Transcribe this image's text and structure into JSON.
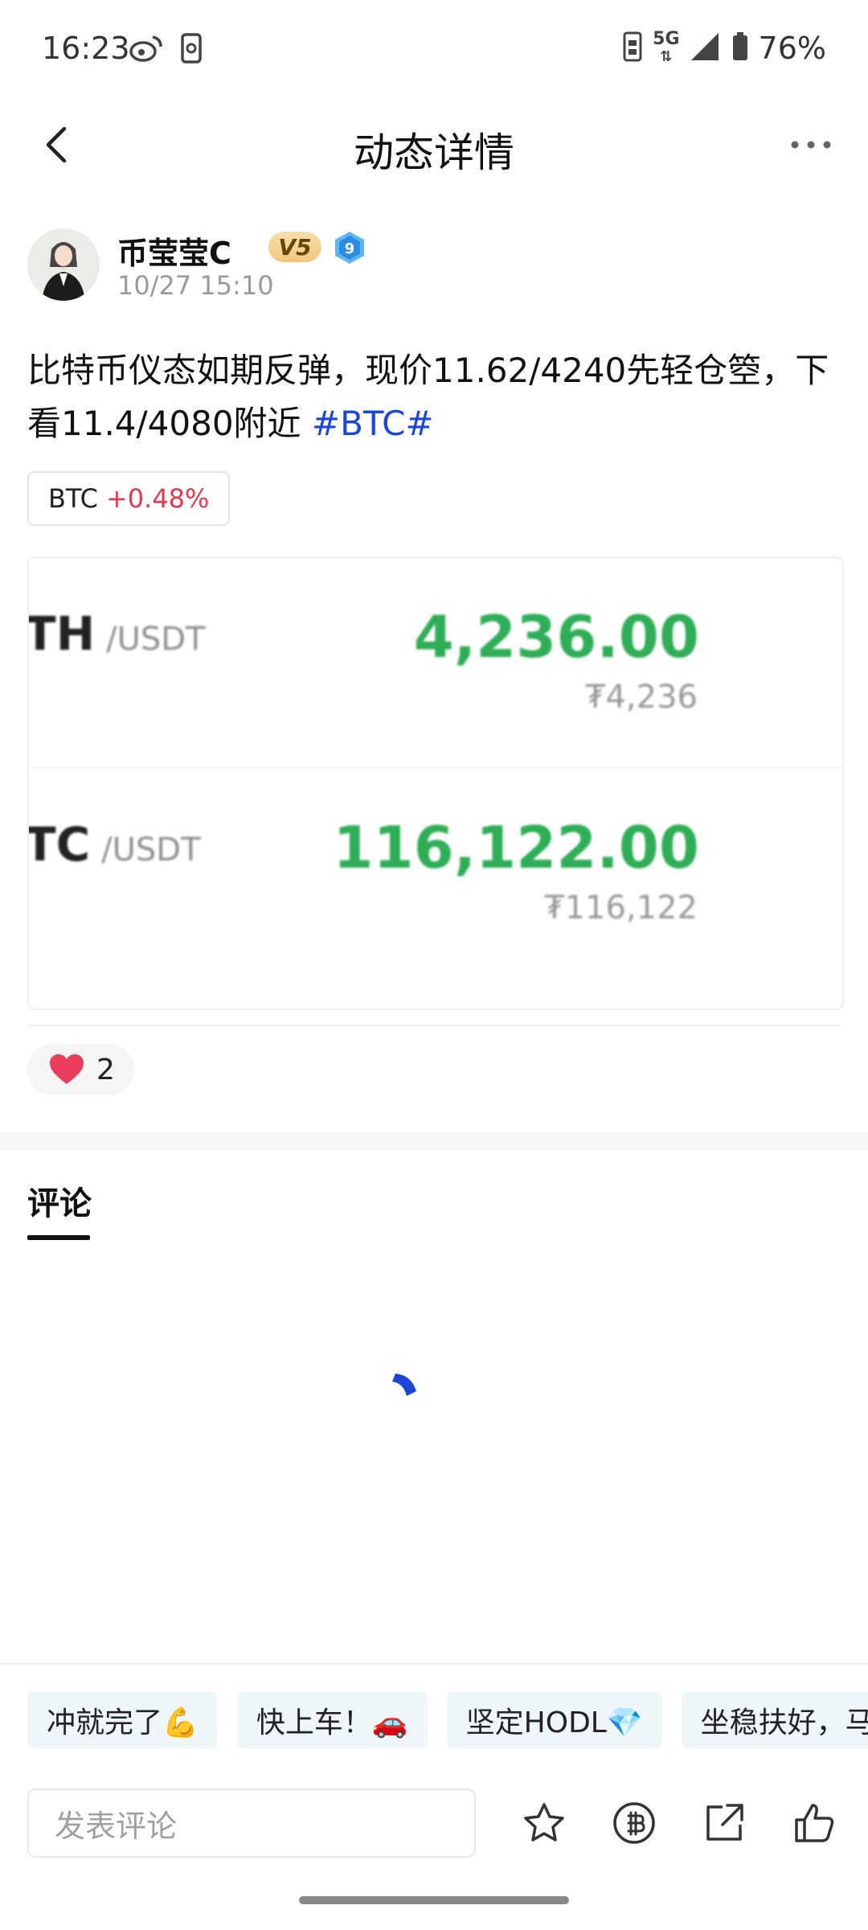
{
  "status_bar": {
    "time": "16:23",
    "network": "5G",
    "battery": "76%",
    "icons": [
      "weibo-icon",
      "phone-sync-icon",
      "sim-icon",
      "signal-icon",
      "battery-icon"
    ]
  },
  "header": {
    "title": "动态详情"
  },
  "author": {
    "name": "币莹莹C",
    "vip_label": "V5",
    "level": "9",
    "time": "10/27 15:10"
  },
  "post": {
    "text": "比特币仪态如期反弹，现价11.62/4240先轻仓箜，下看11.4/4080附近 ",
    "hashtag": "#BTC#",
    "coin_tag": {
      "symbol": "BTC",
      "change": "+0.48%"
    }
  },
  "image_card": {
    "rows": [
      {
        "base": "TH",
        "quote": "/USDT",
        "price": "4,236.00",
        "fiat": "₮4,236"
      },
      {
        "base": "TC",
        "quote": "/USDT",
        "price": "116,122.00",
        "fiat": "₮116,122"
      }
    ]
  },
  "likes": {
    "count": "2"
  },
  "comments": {
    "tab_label": "评论"
  },
  "quick_replies": [
    "冲就完了💪",
    "快上车！🚗",
    "坚定HODL💎",
    "坐稳扶好，马"
  ],
  "bottom_bar": {
    "input_placeholder": "发表评论",
    "actions": [
      "star-icon",
      "tip-icon",
      "share-icon",
      "thumbs-up-icon"
    ]
  },
  "colors": {
    "accent_blue": "#1b47d9",
    "price_green": "#2fae57",
    "change_red": "#e5384f",
    "heart_red": "#ea3e5e"
  }
}
